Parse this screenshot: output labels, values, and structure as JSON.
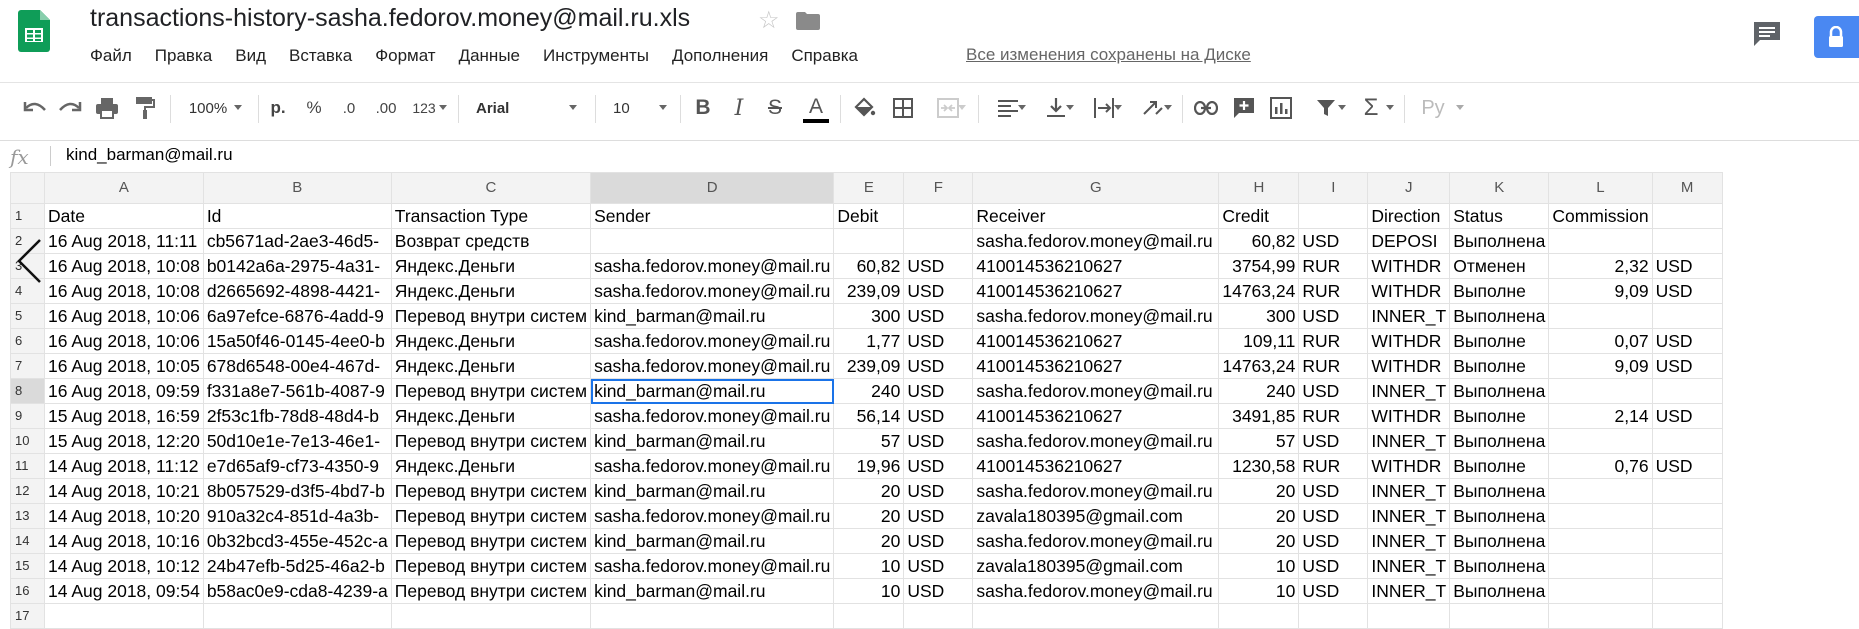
{
  "doc": {
    "title": "transactions-history-sasha.fedorov.money@mail.ru.xls",
    "saved_status": "Все изменения сохранены на Диске"
  },
  "menu": [
    "Файл",
    "Правка",
    "Вид",
    "Вставка",
    "Формат",
    "Данные",
    "Инструменты",
    "Дополнения",
    "Справка"
  ],
  "toolbar": {
    "zoom": "100%",
    "currency": "р.",
    "percent": "%",
    "dec_less": ".0",
    "dec_more": ".00",
    "more_formats": "123",
    "font": "Arial",
    "font_size": "10",
    "input_tools": "Ру"
  },
  "formula_bar": {
    "fx": "fx",
    "value": "kind_barman@mail.ru"
  },
  "columns": [
    "A",
    "B",
    "C",
    "D",
    "E",
    "F",
    "G",
    "H",
    "I",
    "J",
    "K",
    "L",
    "M"
  ],
  "selected_column": "D",
  "selected_row": 8,
  "rows": [
    [
      "Date",
      "Id",
      "Transaction Type",
      "Sender",
      "Debit",
      "",
      "Receiver",
      "Credit",
      "",
      "Direction",
      "Status",
      "Commission",
      ""
    ],
    [
      "16 Aug 2018, 11:11",
      "cb5671ad-2ae3-46d5-",
      "Возврат средств",
      "",
      "",
      "",
      "sasha.fedorov.money@mail.ru",
      "60,82",
      "USD",
      "DEPOSI",
      "Выполнена",
      "",
      ""
    ],
    [
      "16 Aug 2018, 10:08",
      "b0142a6a-2975-4a31-",
      "Яндекс.Деньги",
      "sasha.fedorov.money@mail.ru",
      "60,82",
      "USD",
      "410014536210627",
      "3754,99",
      "RUR",
      "WITHDR",
      "Отменен",
      "2,32",
      "USD"
    ],
    [
      "16 Aug 2018, 10:08",
      "d2665692-4898-4421-",
      "Яндекс.Деньги",
      "sasha.fedorov.money@mail.ru",
      "239,09",
      "USD",
      "410014536210627",
      "14763,24",
      "RUR",
      "WITHDR",
      "Выполне",
      "9,09",
      "USD"
    ],
    [
      "16 Aug 2018, 10:06",
      "6a97efce-6876-4add-9",
      "Перевод внутри систем",
      "kind_barman@mail.ru",
      "300",
      "USD",
      "sasha.fedorov.money@mail.ru",
      "300",
      "USD",
      "INNER_T",
      "Выполнена",
      "",
      ""
    ],
    [
      "16 Aug 2018, 10:06",
      "15a50f46-0145-4ee0-b",
      "Яндекс.Деньги",
      "sasha.fedorov.money@mail.ru",
      "1,77",
      "USD",
      "410014536210627",
      "109,11",
      "RUR",
      "WITHDR",
      "Выполне",
      "0,07",
      "USD"
    ],
    [
      "16 Aug 2018, 10:05",
      "678d6548-00e4-467d-",
      "Яндекс.Деньги",
      "sasha.fedorov.money@mail.ru",
      "239,09",
      "USD",
      "410014536210627",
      "14763,24",
      "RUR",
      "WITHDR",
      "Выполне",
      "9,09",
      "USD"
    ],
    [
      "16 Aug 2018, 09:59",
      "f331a8e7-561b-4087-9",
      "Перевод внутри систем",
      "kind_barman@mail.ru",
      "240",
      "USD",
      "sasha.fedorov.money@mail.ru",
      "240",
      "USD",
      "INNER_T",
      "Выполнена",
      "",
      ""
    ],
    [
      "15 Aug 2018, 16:59",
      "2f53c1fb-78d8-48d4-b",
      "Яндекс.Деньги",
      "sasha.fedorov.money@mail.ru",
      "56,14",
      "USD",
      "410014536210627",
      "3491,85",
      "RUR",
      "WITHDR",
      "Выполне",
      "2,14",
      "USD"
    ],
    [
      "15 Aug 2018, 12:20",
      "50d10e1e-7e13-46e1-",
      "Перевод внутри систем",
      "kind_barman@mail.ru",
      "57",
      "USD",
      "sasha.fedorov.money@mail.ru",
      "57",
      "USD",
      "INNER_T",
      "Выполнена",
      "",
      ""
    ],
    [
      "14 Aug 2018, 11:12",
      "e7d65af9-cf73-4350-9",
      "Яндекс.Деньги",
      "sasha.fedorov.money@mail.ru",
      "19,96",
      "USD",
      "410014536210627",
      "1230,58",
      "RUR",
      "WITHDR",
      "Выполне",
      "0,76",
      "USD"
    ],
    [
      "14 Aug 2018, 10:21",
      "8b057529-d3f5-4bd7-b",
      "Перевод внутри систем",
      "kind_barman@mail.ru",
      "20",
      "USD",
      "sasha.fedorov.money@mail.ru",
      "20",
      "USD",
      "INNER_T",
      "Выполнена",
      "",
      ""
    ],
    [
      "14 Aug 2018, 10:20",
      "910a32c4-851d-4a3b-",
      "Перевод внутри систем",
      "sasha.fedorov.money@mail.ru",
      "20",
      "USD",
      "zavala180395@gmail.com",
      "20",
      "USD",
      "INNER_T",
      "Выполнена",
      "",
      ""
    ],
    [
      "14 Aug 2018, 10:16",
      "0b32bcd3-455e-452c-a",
      "Перевод внутри систем",
      "kind_barman@mail.ru",
      "20",
      "USD",
      "sasha.fedorov.money@mail.ru",
      "20",
      "USD",
      "INNER_T",
      "Выполнена",
      "",
      ""
    ],
    [
      "14 Aug 2018, 10:12",
      "24b47efb-5d25-46a2-b",
      "Перевод внутри систем",
      "sasha.fedorov.money@mail.ru",
      "10",
      "USD",
      "zavala180395@gmail.com",
      "10",
      "USD",
      "INNER_T",
      "Выполнена",
      "",
      ""
    ],
    [
      "14 Aug 2018, 09:54",
      "b58ac0e9-cda8-4239-a",
      "Перевод внутри систем",
      "kind_barman@mail.ru",
      "10",
      "USD",
      "sasha.fedorov.money@mail.ru",
      "10",
      "USD",
      "INNER_T",
      "Выполнена",
      "",
      ""
    ],
    [
      "",
      "",
      "",
      "",
      "",
      "",
      "",
      "",
      "",
      "",
      "",
      "",
      ""
    ]
  ],
  "colors": {
    "accent": "#1a73e8",
    "sheets_green": "#0f9d58",
    "share_blue": "#4a88f2"
  }
}
